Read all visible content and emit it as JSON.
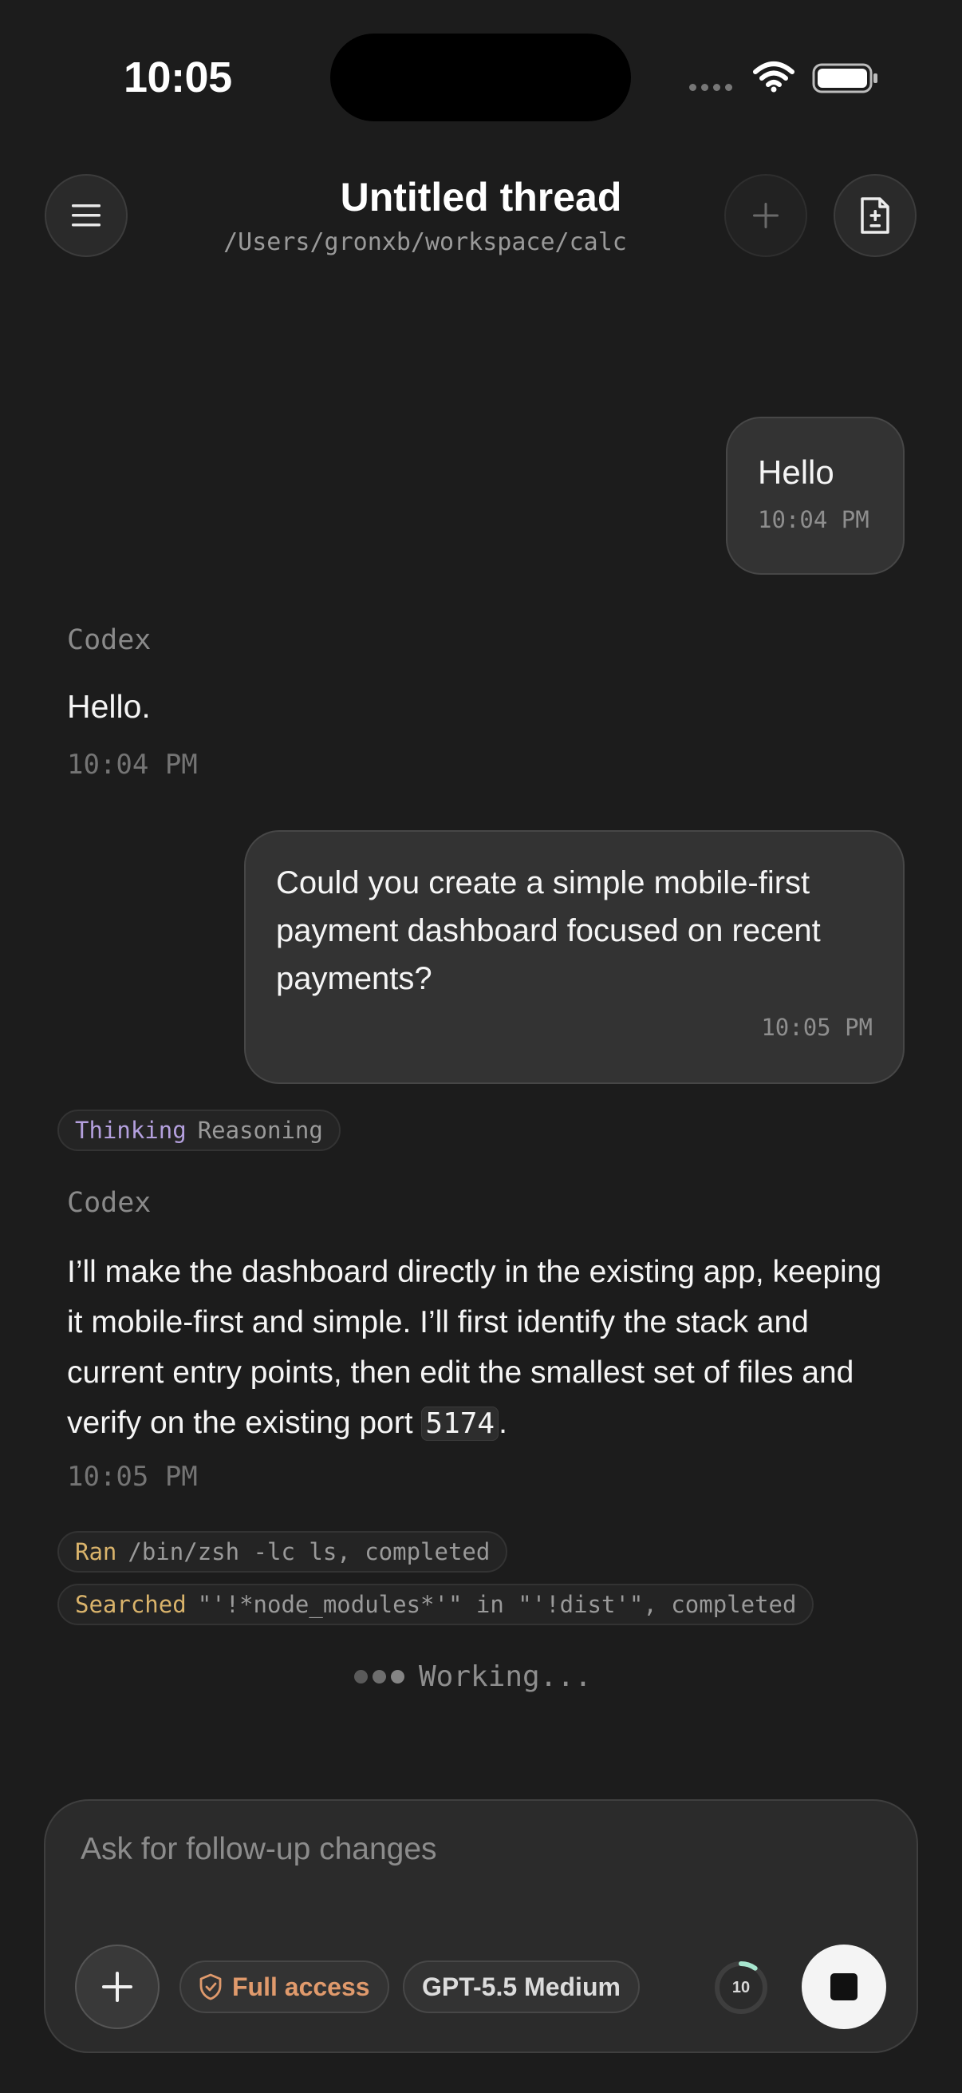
{
  "status_bar": {
    "time": "10:05"
  },
  "header": {
    "title": "Untitled thread",
    "path": "/Users/gronxb/workspace/calc"
  },
  "messages": [
    {
      "role": "user",
      "text": "Hello",
      "time": "10:04 PM"
    },
    {
      "role": "assistant",
      "sender": "Codex",
      "text": "Hello.",
      "time": "10:04 PM"
    },
    {
      "role": "user",
      "text": "Could you create a simple mobile-first payment dashboard focused on recent payments?",
      "time": "10:05 PM"
    },
    {
      "role": "assistant",
      "sender": "Codex",
      "thinking": {
        "label": "Thinking",
        "detail": "Reasoning"
      },
      "text_before_code": "I’ll make the dashboard directly in the existing app, keeping it mobile-first and simple. I’ll first identify the stack and current entry points, then edit the smallest set of files and verify on the existing port ",
      "code": "5174",
      "text_after_code": ".",
      "time": "10:05 PM"
    }
  ],
  "tool_calls": [
    {
      "verb": "Ran",
      "detail": "/bin/zsh -lc ls, completed"
    },
    {
      "verb": "Searched",
      "detail": "\"'!*node_modules*'\" in \"'!dist'\", completed"
    }
  ],
  "working_status": "Working...",
  "composer": {
    "placeholder": "Ask for follow-up changes",
    "access_label": "Full access",
    "model_label": "GPT-5.5 Medium",
    "context_value": "10",
    "context_fraction": 0.1
  },
  "colors": {
    "background": "#1c1c1c",
    "bubble": "#333333",
    "thinking_accent": "#b4a0de",
    "tool_accent": "#d9b36b",
    "access_accent": "#e09a6c",
    "context_ring": "#a8e6cf"
  },
  "icons": {
    "menu": "hamburger-icon",
    "new_thread": "plus-icon",
    "diff": "document-diff-icon",
    "attach": "plus-icon",
    "access": "shield-check-icon",
    "stop": "stop-icon"
  }
}
